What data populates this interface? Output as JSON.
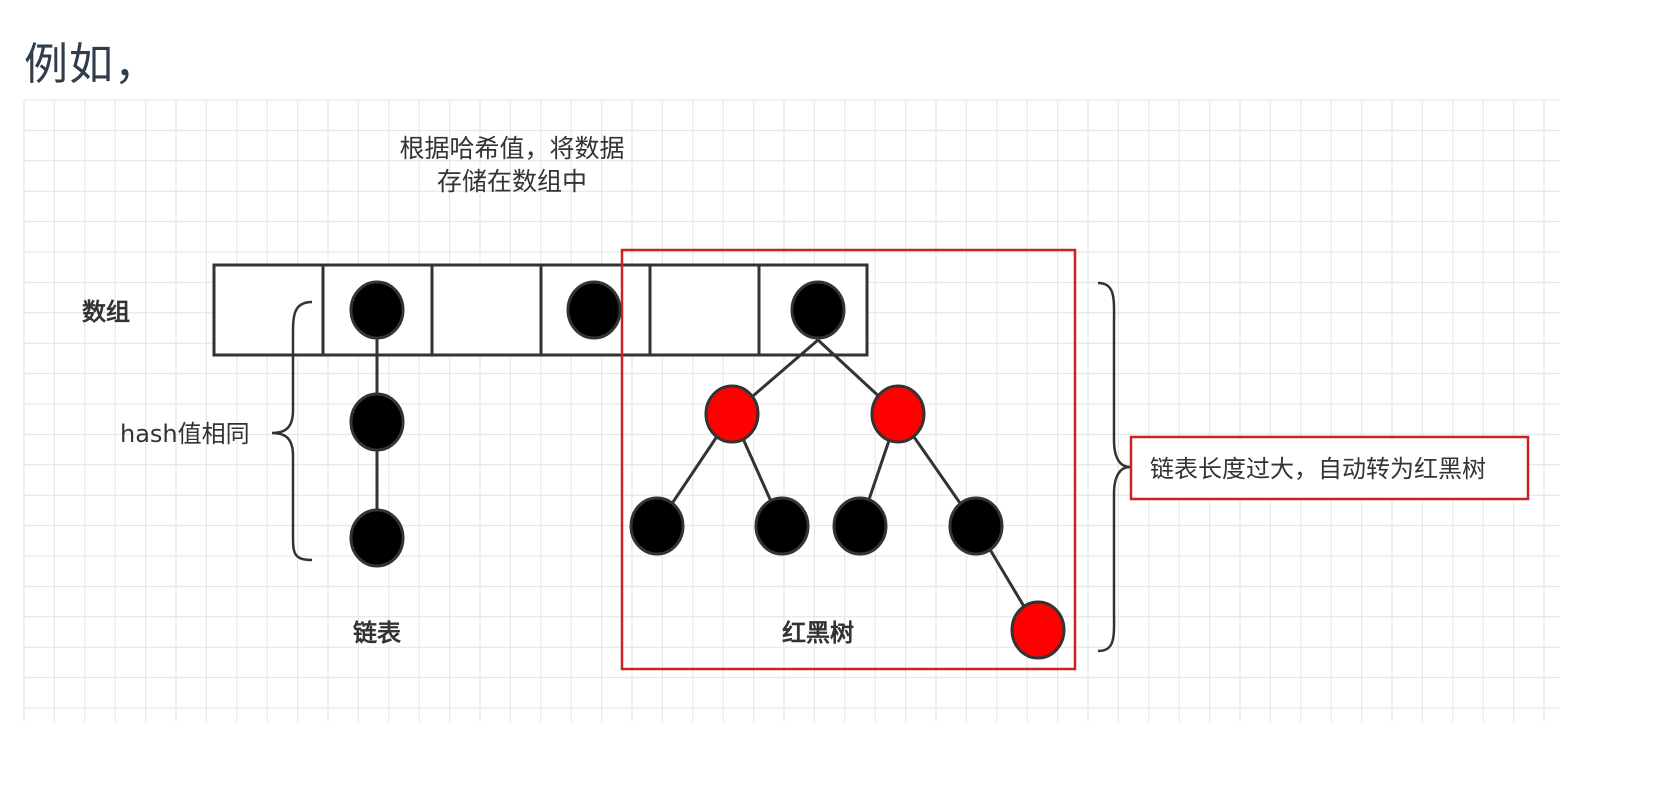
{
  "heading": "例如，",
  "labels": {
    "top_line1": "根据哈希值，将数据",
    "top_line2": "存储在数组中",
    "array": "数组",
    "hash_same": "hash值相同",
    "linked_list": "链表",
    "red_black_tree": "红黑树",
    "note": "链表长度过大，自动转为红黑树"
  },
  "colors": {
    "grid": "#e3e3e3",
    "stroke": "#333333",
    "node_black": "#000000",
    "node_red": "#ff0000",
    "highlight_border": "#cc2222",
    "text": "#333333",
    "heading": "#2f3d4c"
  }
}
